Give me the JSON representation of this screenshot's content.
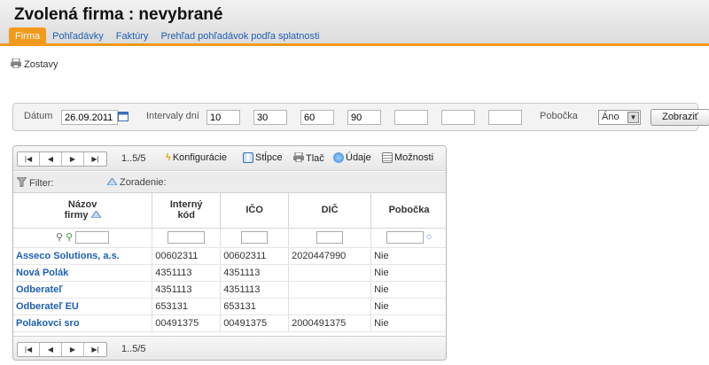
{
  "header": {
    "title": "Zvolená firma :  nevybrané"
  },
  "tabs": [
    {
      "label": "Firma"
    },
    {
      "label": "Pohľadávky"
    },
    {
      "label": "Faktúry"
    },
    {
      "label": "Prehľad pohľadávok podľa splatnosti"
    }
  ],
  "zostavy_label": "Zostavy",
  "filter": {
    "datum_label": "Dátum",
    "datum_value": "26.09.2011",
    "intervaly_label": "Intervaly dní",
    "intervals": [
      "10",
      "30",
      "60",
      "90",
      "",
      "",
      ""
    ],
    "pobocka_label": "Pobočka",
    "pobocka_value": "Áno",
    "zobrazit_label": "Zobraziť"
  },
  "grid": {
    "pages": "1..5/5",
    "toolbar": {
      "konfiguracie": "Konfigurácie",
      "stlpce": "Stĺpce",
      "tlac": "Tlač",
      "udaje": "Údaje",
      "moznosti": "Možnosti"
    },
    "filter_label": "Filter:",
    "zoradenie_label": "Zoradenie:",
    "columns": {
      "nazov1": "Názov",
      "nazov2": "firmy",
      "interny1": "Interný",
      "interny2": "kód",
      "ico": "IČO",
      "dic": "DIČ",
      "pobocka": "Pobočka"
    },
    "rows": [
      {
        "name": "Asseco Solutions, a.s.",
        "kod": "00602311",
        "ico": "00602311",
        "dic": "2020447990",
        "pobocka": "Nie"
      },
      {
        "name": "Nová Polák",
        "kod": "4351113",
        "ico": "4351113",
        "dic": "",
        "pobocka": "Nie"
      },
      {
        "name": "Odberateľ",
        "kod": "4351113",
        "ico": "4351113",
        "dic": "",
        "pobocka": "Nie"
      },
      {
        "name": "Odberateľ EU",
        "kod": "653131",
        "ico": "653131",
        "dic": "",
        "pobocka": "Nie"
      },
      {
        "name": "Polakovci sro",
        "kod": "00491375",
        "ico": "00491375",
        "dic": "2000491375",
        "pobocka": "Nie"
      }
    ]
  },
  "icons": [
    "printer-icon",
    "calendar-icon",
    "first-page-icon",
    "prev-page-icon",
    "next-page-icon",
    "last-page-icon",
    "lightning-icon",
    "columns-icon",
    "print-icon",
    "data-icon",
    "options-icon",
    "funnel-icon",
    "sort-icon",
    "search-icon",
    "clear-search-icon",
    "bulb-icon"
  ]
}
